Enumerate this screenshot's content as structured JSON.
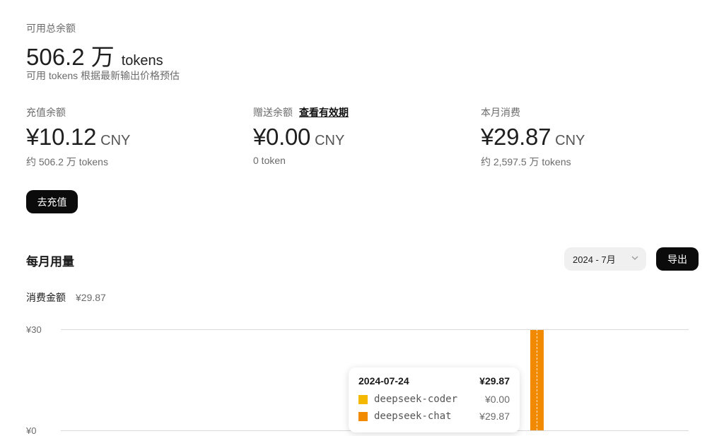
{
  "total_balance": {
    "label": "可用总余额",
    "amount": "506.2 万",
    "unit": "tokens",
    "note": "可用 tokens 根据最新输出价格预估"
  },
  "cards": [
    {
      "label": "充值余额",
      "amount": "¥10.12",
      "currency": "CNY",
      "sub": "约 506.2 万 tokens"
    },
    {
      "label": "赠送余额",
      "link": "查看有效期",
      "amount": "¥0.00",
      "currency": "CNY",
      "sub": "0 token"
    },
    {
      "label": "本月消费",
      "amount": "¥29.87",
      "currency": "CNY",
      "sub": "约 2,597.5 万 tokens"
    }
  ],
  "recharge_button": "去充值",
  "usage": {
    "title": "每月用量",
    "month_select": "2024 - 7月",
    "export_button": "导出",
    "spend_label": "消费金额",
    "spend_value": "¥29.87"
  },
  "chart_data": {
    "type": "bar",
    "ylim": [
      0,
      30
    ],
    "y_ticks": [
      "¥30",
      "¥0"
    ],
    "categories": [
      "2024-07-24"
    ],
    "series": [
      {
        "name": "deepseek-coder",
        "values": [
          0.0
        ],
        "color": "#F5B800"
      },
      {
        "name": "deepseek-chat",
        "values": [
          29.87
        ],
        "color": "#F18A00"
      }
    ],
    "tooltip": {
      "date": "2024-07-24",
      "total": "¥29.87",
      "rows": [
        {
          "name": "deepseek-coder",
          "value": "¥0.00",
          "color": "#F5B800"
        },
        {
          "name": "deepseek-chat",
          "value": "¥29.87",
          "color": "#F18A00"
        }
      ]
    }
  }
}
